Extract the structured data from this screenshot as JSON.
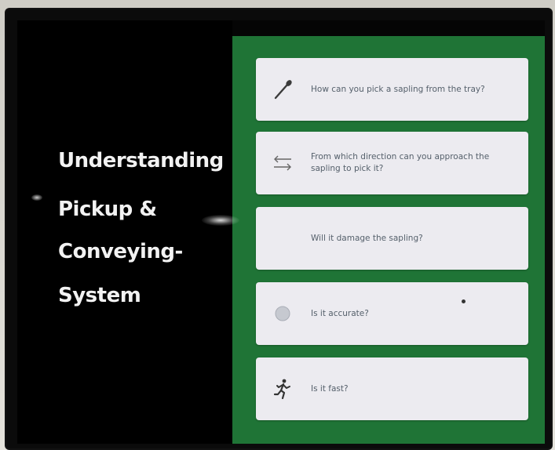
{
  "slide": {
    "title_lines": [
      "Understanding",
      "Pickup &",
      "Conveying-",
      "System"
    ]
  },
  "questions": [
    {
      "icon": "pencil-icon",
      "text": "How can you pick a sapling from the tray?"
    },
    {
      "icon": "arrows-left-right-icon",
      "text": "From which direction can you approach the sapling to pick it?"
    },
    {
      "icon": "",
      "text": "Will it damage the sapling?"
    },
    {
      "icon": "circle-icon",
      "text": "Is it accurate?"
    },
    {
      "icon": "running-person-icon",
      "text": "Is it fast?"
    }
  ],
  "colors": {
    "green_panel": "#1f7436",
    "card": "#ecebf0",
    "title_text": "#f2f2f2"
  }
}
